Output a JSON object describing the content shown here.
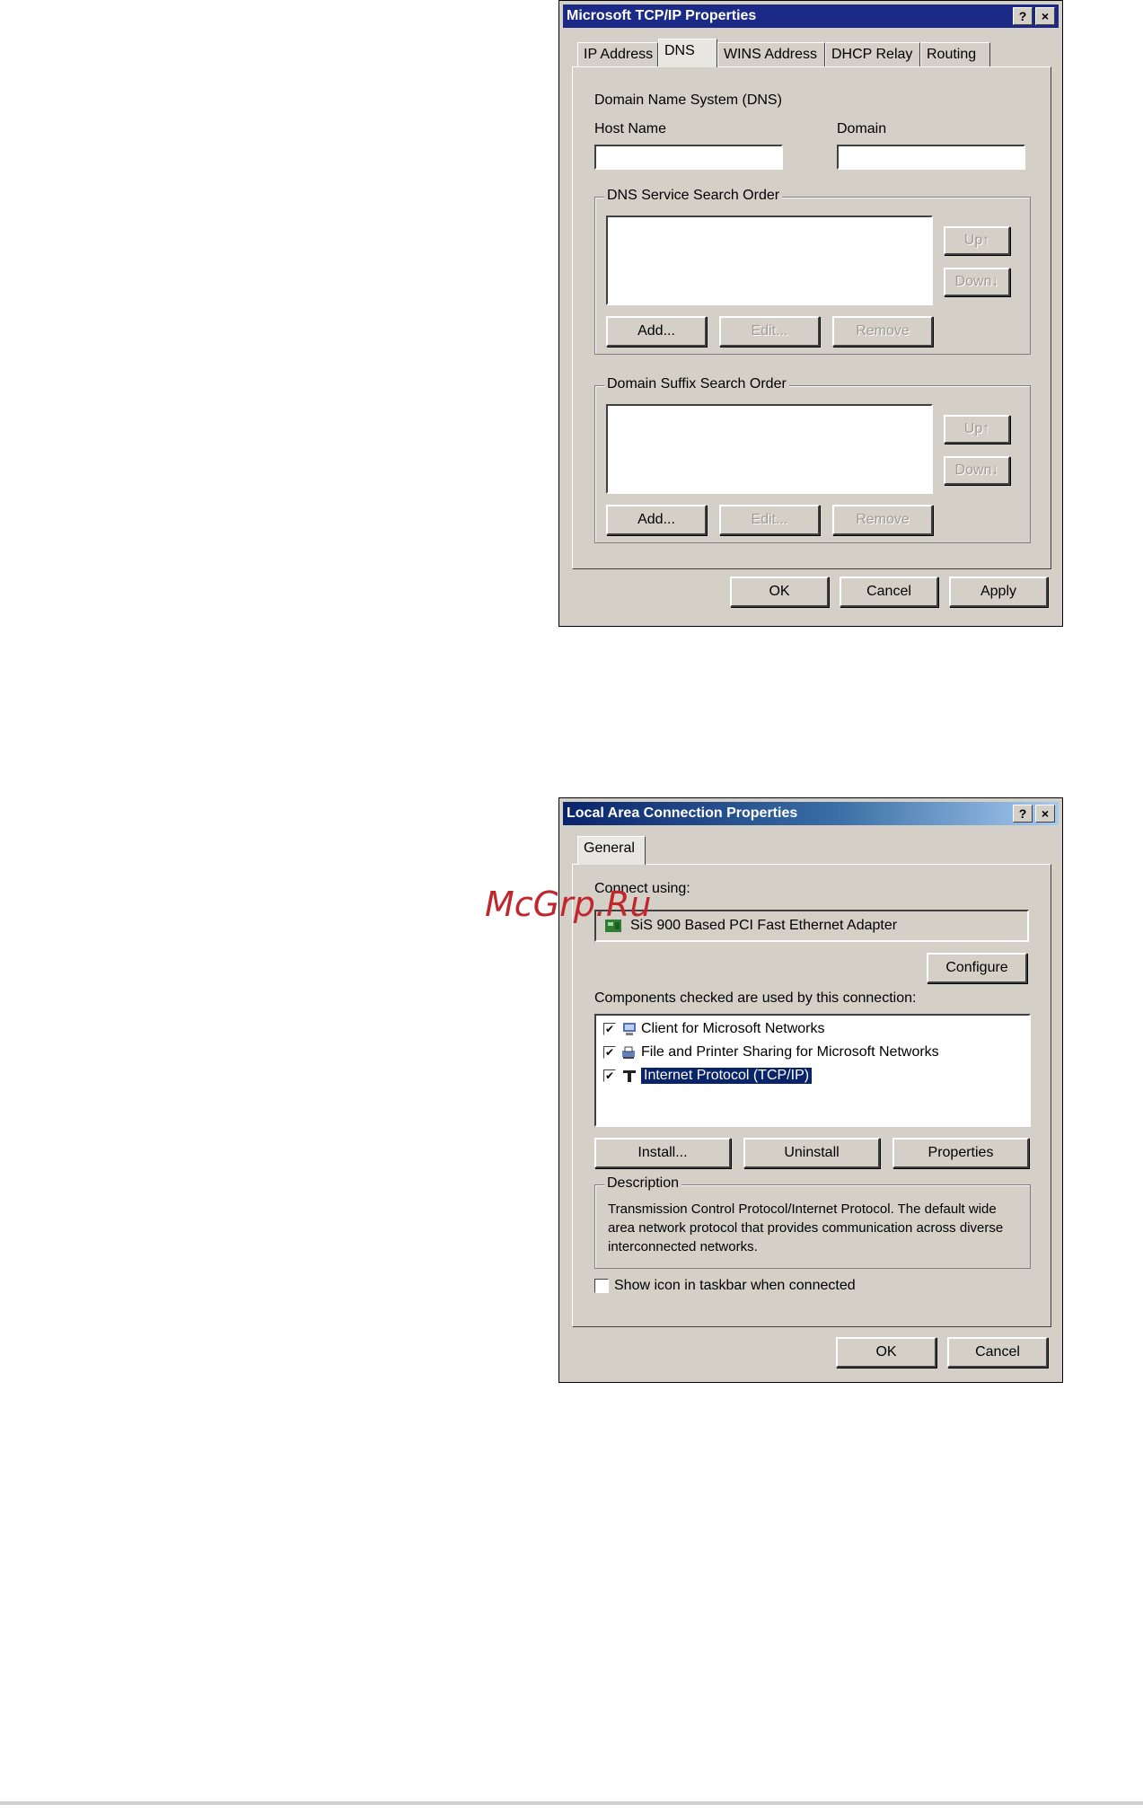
{
  "tcpip_dialog": {
    "title": "Microsoft TCP/IP Properties",
    "help_btn": "?",
    "close_btn": "×",
    "tabs": [
      {
        "label": "IP Address"
      },
      {
        "label": "DNS"
      },
      {
        "label": "WINS Address"
      },
      {
        "label": "DHCP Relay"
      },
      {
        "label": "Routing"
      }
    ],
    "section_label": "Domain Name System (DNS)",
    "host_name_label": "Host Name",
    "host_name_value": "",
    "domain_label": "Domain",
    "domain_value": "",
    "dns_group": {
      "legend": "DNS Service Search Order",
      "up": "Up↑",
      "down": "Down↓",
      "add": "Add...",
      "edit": "Edit...",
      "remove": "Remove"
    },
    "suffix_group": {
      "legend": "Domain Suffix Search Order",
      "up": "Up↑",
      "down": "Down↓",
      "add": "Add...",
      "edit": "Edit...",
      "remove": "Remove"
    },
    "ok": "OK",
    "cancel": "Cancel",
    "apply": "Apply"
  },
  "lan_dialog": {
    "title": "Local Area Connection Properties",
    "help_btn": "?",
    "close_btn": "×",
    "tab_general": "General",
    "connect_using_label": "Connect using:",
    "adapter_name": "SiS 900 Based PCI Fast Ethernet Adapter",
    "configure": "Configure",
    "components_label": "Components checked are used by this connection:",
    "components": [
      {
        "label": "Client for Microsoft Networks",
        "checked": "✔"
      },
      {
        "label": "File and Printer Sharing for Microsoft Networks",
        "checked": "✔"
      },
      {
        "label": "Internet Protocol (TCP/IP)",
        "checked": "✔"
      }
    ],
    "install": "Install...",
    "uninstall": "Uninstall",
    "properties": "Properties",
    "description_legend": "Description",
    "description_text": "Transmission Control Protocol/Internet Protocol. The default wide area network protocol that provides communication across diverse interconnected networks.",
    "show_icon_label": "Show icon in taskbar when connected",
    "ok": "OK",
    "cancel": "Cancel"
  },
  "watermark": "McGrp.Ru",
  "colors": {
    "dialog_face": "#d4d0c8",
    "title_classic": "#1b2a86",
    "selection": "#0a246a",
    "watermark": "#c0272d"
  }
}
